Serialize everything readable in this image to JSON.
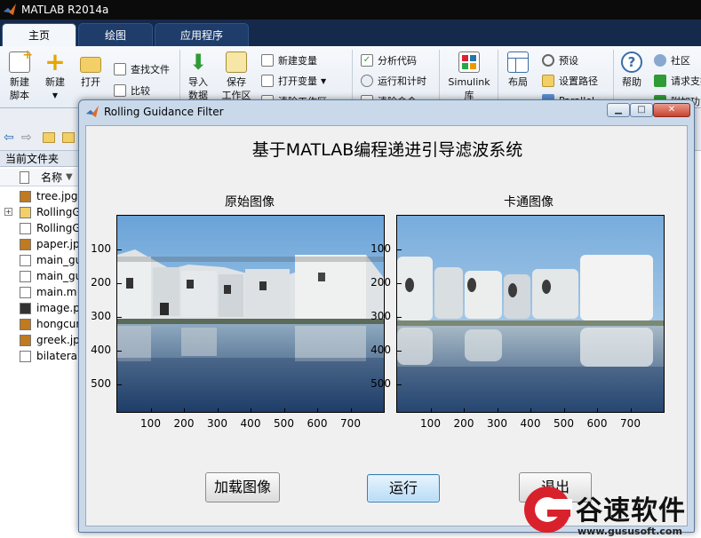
{
  "app": {
    "title": "MATLAB R2014a"
  },
  "tabs": [
    {
      "label": "主页",
      "active": true
    },
    {
      "label": "绘图",
      "active": false
    },
    {
      "label": "应用程序",
      "active": false
    }
  ],
  "ribbon": {
    "new_script": "新建\n脚本",
    "new": "新建",
    "open": "打开",
    "find_files": "查找文件",
    "compare": "比较",
    "import_data": "导入\n数据",
    "save_workspace": "保存\n工作区",
    "new_variable": "新建变量",
    "open_variable": "打开变量",
    "clear_workspace": "清除工作区",
    "analyze_code": "分析代码",
    "run_and_time": "运行和计时",
    "clear_commands": "清除命令",
    "simulink": "Simulink",
    "simulink_2": "库",
    "layout": "布局",
    "preferences": "预设",
    "set_path": "设置路径",
    "parallel": "Parallel",
    "help": "帮助",
    "community": "社区",
    "request_support": "请求支持",
    "addons": "附加功能"
  },
  "file_browser": {
    "panel_title": "当前文件夹",
    "column_name": "名称",
    "files": [
      {
        "name": "tree.jpg",
        "type": "jpg",
        "expandable": false
      },
      {
        "name": "RollingGuidanceFilter",
        "type": "folder",
        "expandable": true
      },
      {
        "name": "RollingGuidanceFilter.m",
        "type": "m",
        "expandable": false
      },
      {
        "name": "paper.jpg",
        "type": "jpg",
        "expandable": false
      },
      {
        "name": "main_gui.fig",
        "type": "fig",
        "expandable": false
      },
      {
        "name": "main_gui.m",
        "type": "m",
        "expandable": false
      },
      {
        "name": "main.m",
        "type": "m",
        "expandable": false
      },
      {
        "name": "image.png",
        "type": "png",
        "expandable": false
      },
      {
        "name": "hongcun.jpg",
        "type": "jpg",
        "expandable": false
      },
      {
        "name": "greek.jpg",
        "type": "jpg",
        "expandable": false
      },
      {
        "name": "bilateralFilter.m",
        "type": "m",
        "expandable": false
      }
    ]
  },
  "figure": {
    "window_title": "Rolling Guidance Filter",
    "main_title": "基于MATLAB编程递进引导滤波系统",
    "axes": [
      {
        "title": "原始图像",
        "yticks": [
          "100",
          "200",
          "300",
          "400",
          "500"
        ],
        "xticks": [
          "100",
          "200",
          "300",
          "400",
          "500",
          "600",
          "700"
        ]
      },
      {
        "title": "卡通图像",
        "yticks": [
          "100",
          "200",
          "300",
          "400",
          "500"
        ],
        "xticks": [
          "100",
          "200",
          "300",
          "400",
          "500",
          "600",
          "700"
        ]
      }
    ],
    "buttons": {
      "load": "加载图像",
      "run": "运行",
      "exit": "退出"
    },
    "window_controls": {
      "minimize": "▁",
      "maximize": "□",
      "close": "✕"
    }
  },
  "watermark": {
    "name": "谷速软件",
    "url": "www.gususoft.com"
  },
  "colors": {
    "titlebar": "#0b0b0b",
    "tabbar": "#15294a",
    "brand_red": "#d9212b",
    "sky": "#7fb2de",
    "water": "#2c4f7e"
  }
}
